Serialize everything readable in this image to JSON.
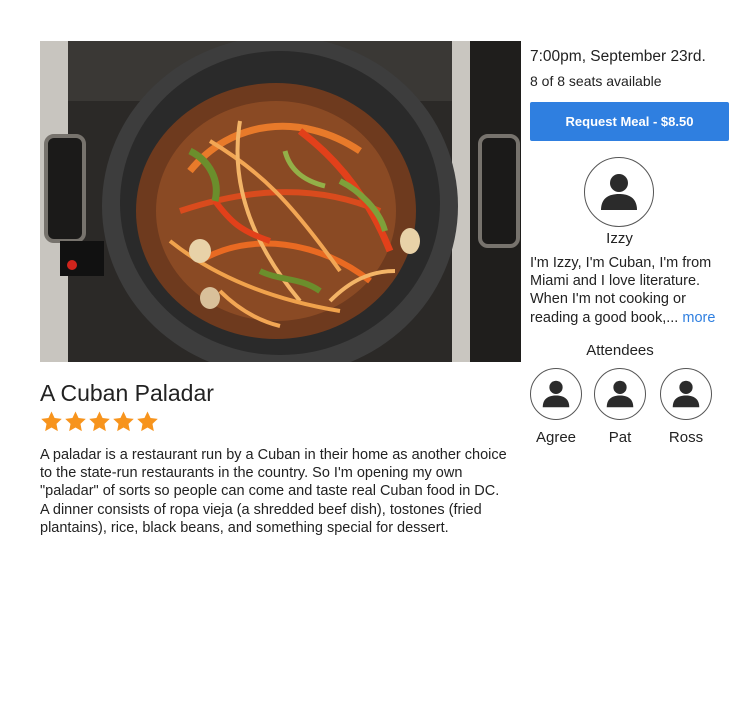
{
  "meal": {
    "title": "A Cuban Paladar",
    "rating": 5,
    "rating_max": 5,
    "star_color": "#f7941d",
    "description": "A paladar is a restaurant run by a Cuban in their home as another choice to the state-run restaurants in the country. So I'm opening my own \"paladar\" of sorts so people can come and taste real Cuban food in DC. A dinner consists of ropa vieja (a shredded beef dish), tostones (fried plantains), rice, black beans, and something special for dessert."
  },
  "event": {
    "time": "7:00pm, September 23rd.",
    "seats": "8 of 8 seats available",
    "request_label": "Request Meal - $8.50",
    "button_color": "#2f7fe0"
  },
  "host": {
    "name": "Izzy",
    "bio": "I'm Izzy, I'm Cuban, I'm from Miami and I love literature. When I'm not cooking or reading a good book,...",
    "more_label": "more",
    "avatar_icon": "user-icon"
  },
  "attendees": {
    "heading": "Attendees",
    "people": [
      {
        "name": "Agree",
        "avatar_icon": "user-icon"
      },
      {
        "name": "Pat",
        "avatar_icon": "user-icon"
      },
      {
        "name": "Ross",
        "avatar_icon": "user-icon"
      }
    ]
  }
}
